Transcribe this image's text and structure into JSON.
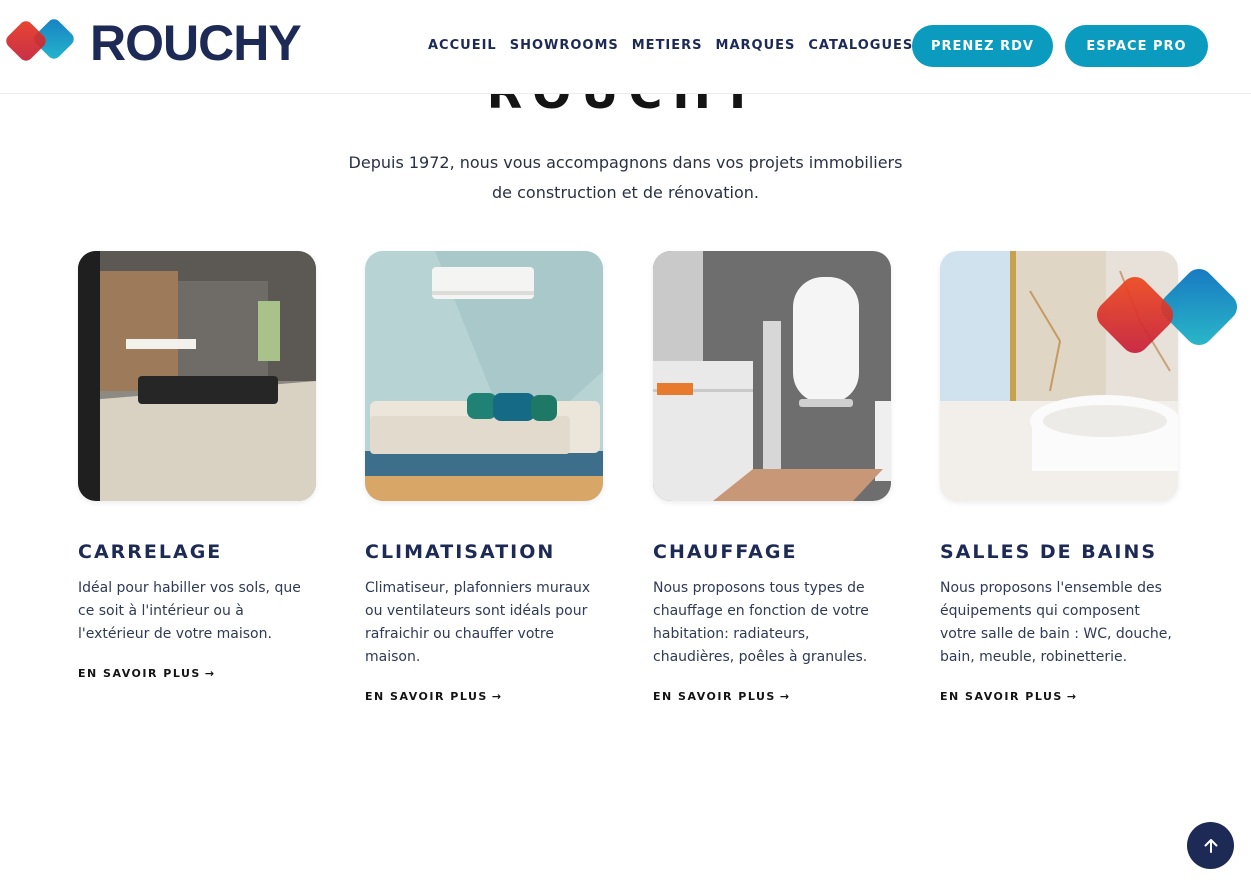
{
  "hero": {
    "title": "ROUCHY",
    "intro_line1": "Depuis 1972, nous vous accompagnons dans vos projets immobiliers",
    "intro_line2": "de construction et de rénovation."
  },
  "header": {
    "brand": "ROUCHY",
    "nav": [
      "ACCUEIL",
      "SHOWROOMS",
      "METIERS",
      "MARQUES",
      "CATALOGUES"
    ],
    "cta_rdv": "PRENEZ RDV",
    "cta_pro": "ESPACE PRO"
  },
  "cards": [
    {
      "title": "CARRELAGE",
      "description": "Idéal pour habiller vos sols, que ce soit à l'intérieur ou à l'extérieur de votre maison.",
      "link": "EN SAVOIR PLUS"
    },
    {
      "title": "CLIMATISATION",
      "description": "Climatiseur, plafonniers muraux ou ventilateurs sont idéals pour rafraichir ou chauffer votre maison.",
      "link": "EN SAVOIR PLUS"
    },
    {
      "title": "CHAUFFAGE",
      "description": "Nous proposons tous types de chauffage en fonction de votre habitation: radiateurs, chaudières, poêles à granules.",
      "link": "EN SAVOIR PLUS"
    },
    {
      "title": "SALLES DE BAINS",
      "description": "Nous proposons l'ensemble des équipements qui composent votre salle de bain : WC, douche, bain, meuble, robinetterie.",
      "link": "EN SAVOIR PLUS"
    }
  ],
  "icons": {
    "link_arrow": "arrow-right-icon",
    "scroll_top": "arrow-up-icon"
  },
  "colors": {
    "primary": "#1d2a56",
    "accent": "#0a9bbf",
    "logo_red": "#e8361e",
    "logo_blue": "#0b79c0"
  }
}
